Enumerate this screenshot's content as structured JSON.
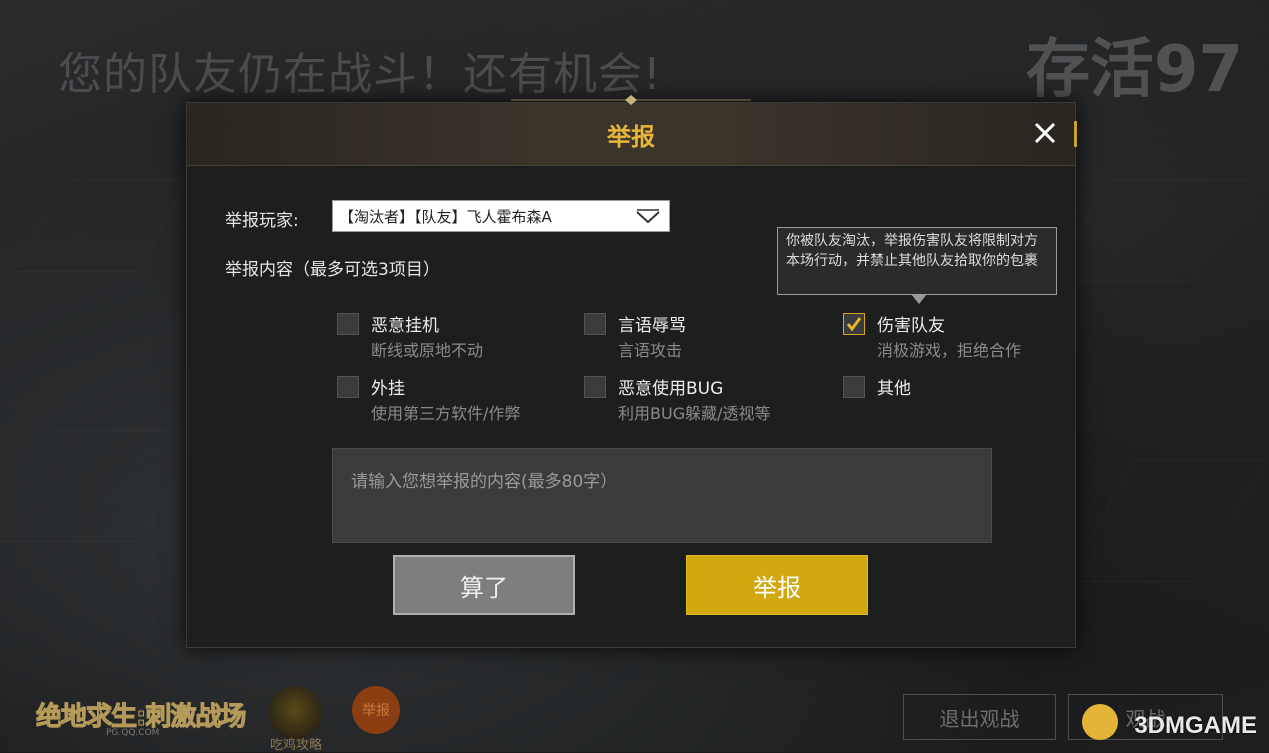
{
  "background": {
    "message": "您的队友仍在战斗！还有机会!",
    "alive": "存活97"
  },
  "dialog": {
    "title": "举报",
    "player_label": "举报玩家:",
    "player_value": "【淘汰者】【队友】飞人霍布森A",
    "content_label": "举报内容（最多可选3项目）",
    "tooltip": "你被队友淘汰，举报伤害队友将限制对方本场行动，并禁止其他队友拾取你的包裹",
    "options": [
      {
        "title": "恶意挂机",
        "sub": "断线或原地不动",
        "checked": false
      },
      {
        "title": "言语辱骂",
        "sub": "言语攻击",
        "checked": false
      },
      {
        "title": "伤害队友",
        "sub": "消极游戏，拒绝合作",
        "checked": true
      },
      {
        "title": "外挂",
        "sub": "使用第三方软件/作弊",
        "checked": false
      },
      {
        "title": "恶意使用BUG",
        "sub": "利用BUG躲藏/透视等",
        "checked": false
      },
      {
        "title": "其他",
        "sub": "",
        "checked": false
      }
    ],
    "textarea_placeholder": "请输入您想举报的内容(最多80字）",
    "cancel_label": "算了",
    "submit_label": "举报",
    "accent_color": "#d2a80f"
  },
  "bottom": {
    "logo_text": "绝地求生:刺激战场",
    "logo_sub": "PG.QQ.COM",
    "guide_label": "吃鸡攻略",
    "report_label": "举报",
    "exit_label": "退出观战",
    "watch_label": "观战",
    "watermark": "3DMGAME"
  }
}
